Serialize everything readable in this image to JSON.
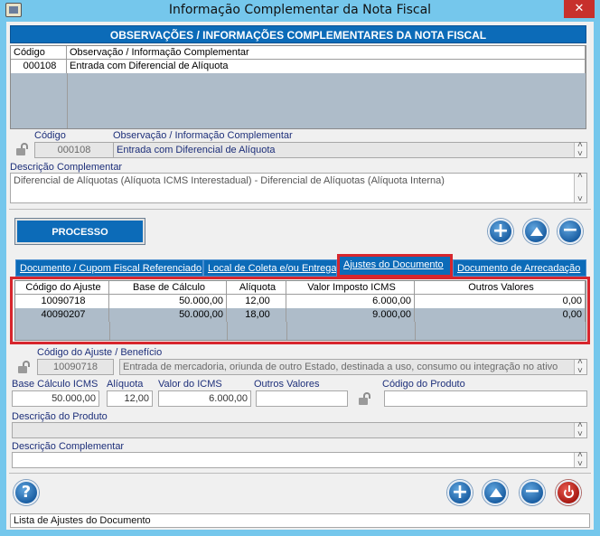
{
  "window": {
    "title": "Informação Complementar da Nota Fiscal",
    "close_glyph": "✕"
  },
  "top": {
    "header": "OBSERVAÇÕES / INFORMAÇÕES COMPLEMENTARES DA NOTA FISCAL",
    "columns": [
      "Código",
      "Observação / Informação Complementar"
    ],
    "rows": [
      {
        "codigo": "000108",
        "obs": "Entrada com Diferencial de Alíquota"
      }
    ],
    "codigo_label": "Código",
    "codigo_value": "000108",
    "obs_label": "Observação / Informação Complementar",
    "obs_value": "Entrada com Diferencial de Alíquota",
    "desc_label": "Descrição Complementar",
    "desc_value": "Diferencial de Alíquotas (Alíquota ICMS Interestadual) - Diferencial de Alíquotas (Alíquota Interna)"
  },
  "process": {
    "button": "PROCESSO",
    "add": "+",
    "remove": "−"
  },
  "tabs": [
    {
      "label": "Documento / Cupom Fiscal Referenciado"
    },
    {
      "label": "Local de Coleta e/ou Entrega"
    },
    {
      "label": "Ajustes do Documento"
    },
    {
      "label": "Documento de Arrecadação"
    }
  ],
  "ajustes": {
    "columns": [
      "Código do Ajuste",
      "Base de Cálculo",
      "Alíquota",
      "Valor Imposto ICMS",
      "Outros Valores"
    ],
    "rows": [
      {
        "codigo": "10090718",
        "base": "50.000,00",
        "aliquota": "12,00",
        "valor": "6.000,00",
        "outros": "0,00"
      },
      {
        "codigo": "40090207",
        "base": "50.000,00",
        "aliquota": "18,00",
        "valor": "9.000,00",
        "outros": "0,00"
      }
    ]
  },
  "detail": {
    "codigo_ajuste_label": "Código do Ajuste / Benefício",
    "codigo_ajuste_value": "10090718",
    "codigo_ajuste_desc": "Entrada de mercadoria, oriunda de outro Estado, destinada a uso, consumo ou integração no ativo",
    "base_label": "Base Cálculo ICMS",
    "base_value": "50.000,00",
    "aliquota_label": "Alíquota",
    "aliquota_value": "12,00",
    "valor_label": "Valor do ICMS",
    "valor_value": "6.000,00",
    "outros_label": "Outros Valores",
    "outros_value": "",
    "produto_label": "Código do Produto",
    "produto_value": "",
    "desc_produto_label": "Descrição do Produto",
    "desc_produto_value": "",
    "desc_compl_label": "Descrição Complementar",
    "desc_compl_value": ""
  },
  "footer": {
    "help": "?",
    "add": "+",
    "remove": "−",
    "status": "Lista de Ajustes do Documento"
  }
}
